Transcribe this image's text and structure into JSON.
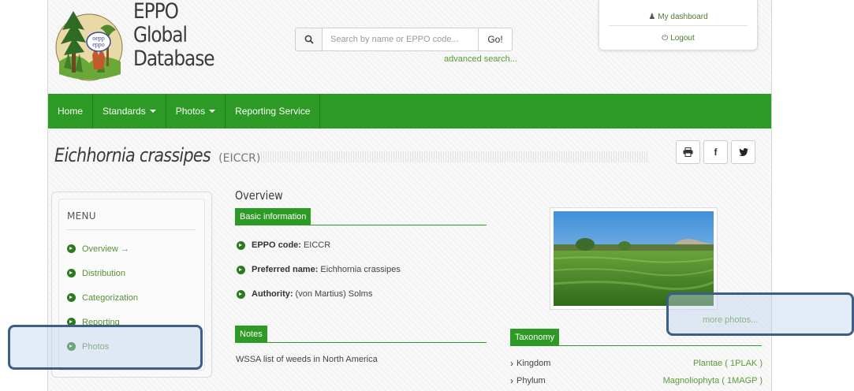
{
  "header": {
    "site_title_lines": [
      "EPPO",
      "Global",
      "Database"
    ],
    "logo_badge_lines": [
      "oepp",
      "eppo"
    ],
    "search": {
      "placeholder": "Search by name or EPPO code...",
      "go_label": "Go!",
      "advanced_label": "advanced search..."
    },
    "user": {
      "dashboard_label": "My dashboard",
      "logout_label": "Logout"
    }
  },
  "nav": {
    "items": [
      {
        "label": "Home",
        "dropdown": false
      },
      {
        "label": "Standards",
        "dropdown": true
      },
      {
        "label": "Photos",
        "dropdown": true
      },
      {
        "label": "Reporting Service",
        "dropdown": false
      }
    ]
  },
  "page": {
    "species_name": "Eichhornia crassipes",
    "eppo_code_display": "(EICCR)",
    "share": {
      "print_icon": "print-icon",
      "facebook_glyph": "f",
      "twitter_glyph": "twitter-icon"
    }
  },
  "menu": {
    "title": "MENU",
    "items": [
      {
        "label": "Overview →"
      },
      {
        "label": "Distribution"
      },
      {
        "label": "Categorization"
      },
      {
        "label": "Reporting"
      },
      {
        "label": "Photos"
      }
    ]
  },
  "overview": {
    "title": "Overview",
    "basic_info_label": "Basic information",
    "rows": [
      {
        "key": "EPPO code:",
        "value": "EICCR"
      },
      {
        "key": "Preferred name:",
        "value": "Eichhornia crassipes"
      },
      {
        "key": "Authority:",
        "value": "(von Martius) Solms"
      }
    ],
    "notes_label": "Notes",
    "notes_text": "WSSA list of weeds in North America"
  },
  "photo": {
    "more_label": "more photos..."
  },
  "taxonomy": {
    "label": "Taxonomy",
    "rows": [
      {
        "rank": "Kingdom",
        "value": "Plantae ( 1PLAK )"
      },
      {
        "rank": "Phylum",
        "value": "Magnoliophyta ( 1MAGP )"
      }
    ]
  },
  "colors": {
    "nav_green": "#2c9a24",
    "link_green": "#5d9b3a",
    "highlight_border": "#3d5f86"
  }
}
